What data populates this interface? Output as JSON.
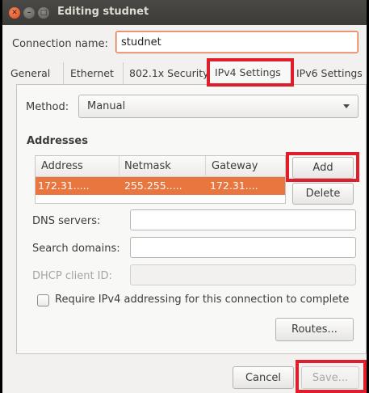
{
  "window": {
    "title": "Editing studnet",
    "close_glyph": "✕",
    "min_glyph": "–",
    "max_glyph": "□"
  },
  "connection": {
    "label": "Connection name:",
    "value": "studnet"
  },
  "tabs": [
    {
      "label": "General"
    },
    {
      "label": "Ethernet"
    },
    {
      "label": "802.1x Security"
    },
    {
      "label": "IPv4 Settings"
    },
    {
      "label": "IPv6 Settings"
    }
  ],
  "method": {
    "label": "Method:",
    "value": "Manual"
  },
  "addresses": {
    "heading": "Addresses",
    "columns": [
      "Address",
      "Netmask",
      "Gateway"
    ],
    "rows": [
      [
        "172.31.....",
        "255.255.....",
        "172.31...."
      ]
    ],
    "add_label": "Add",
    "delete_label": "Delete"
  },
  "fields": {
    "dns_label": "DNS servers:",
    "search_label": "Search domains:",
    "dhcp_label": "DHCP client ID:"
  },
  "require_ipv4": {
    "label": "Require IPv4 addressing for this connection to complete",
    "checked": false
  },
  "buttons": {
    "routes": "Routes...",
    "cancel": "Cancel",
    "save": "Save..."
  },
  "colors": {
    "selection": "#e9763f",
    "highlight": "#e01e2b"
  }
}
